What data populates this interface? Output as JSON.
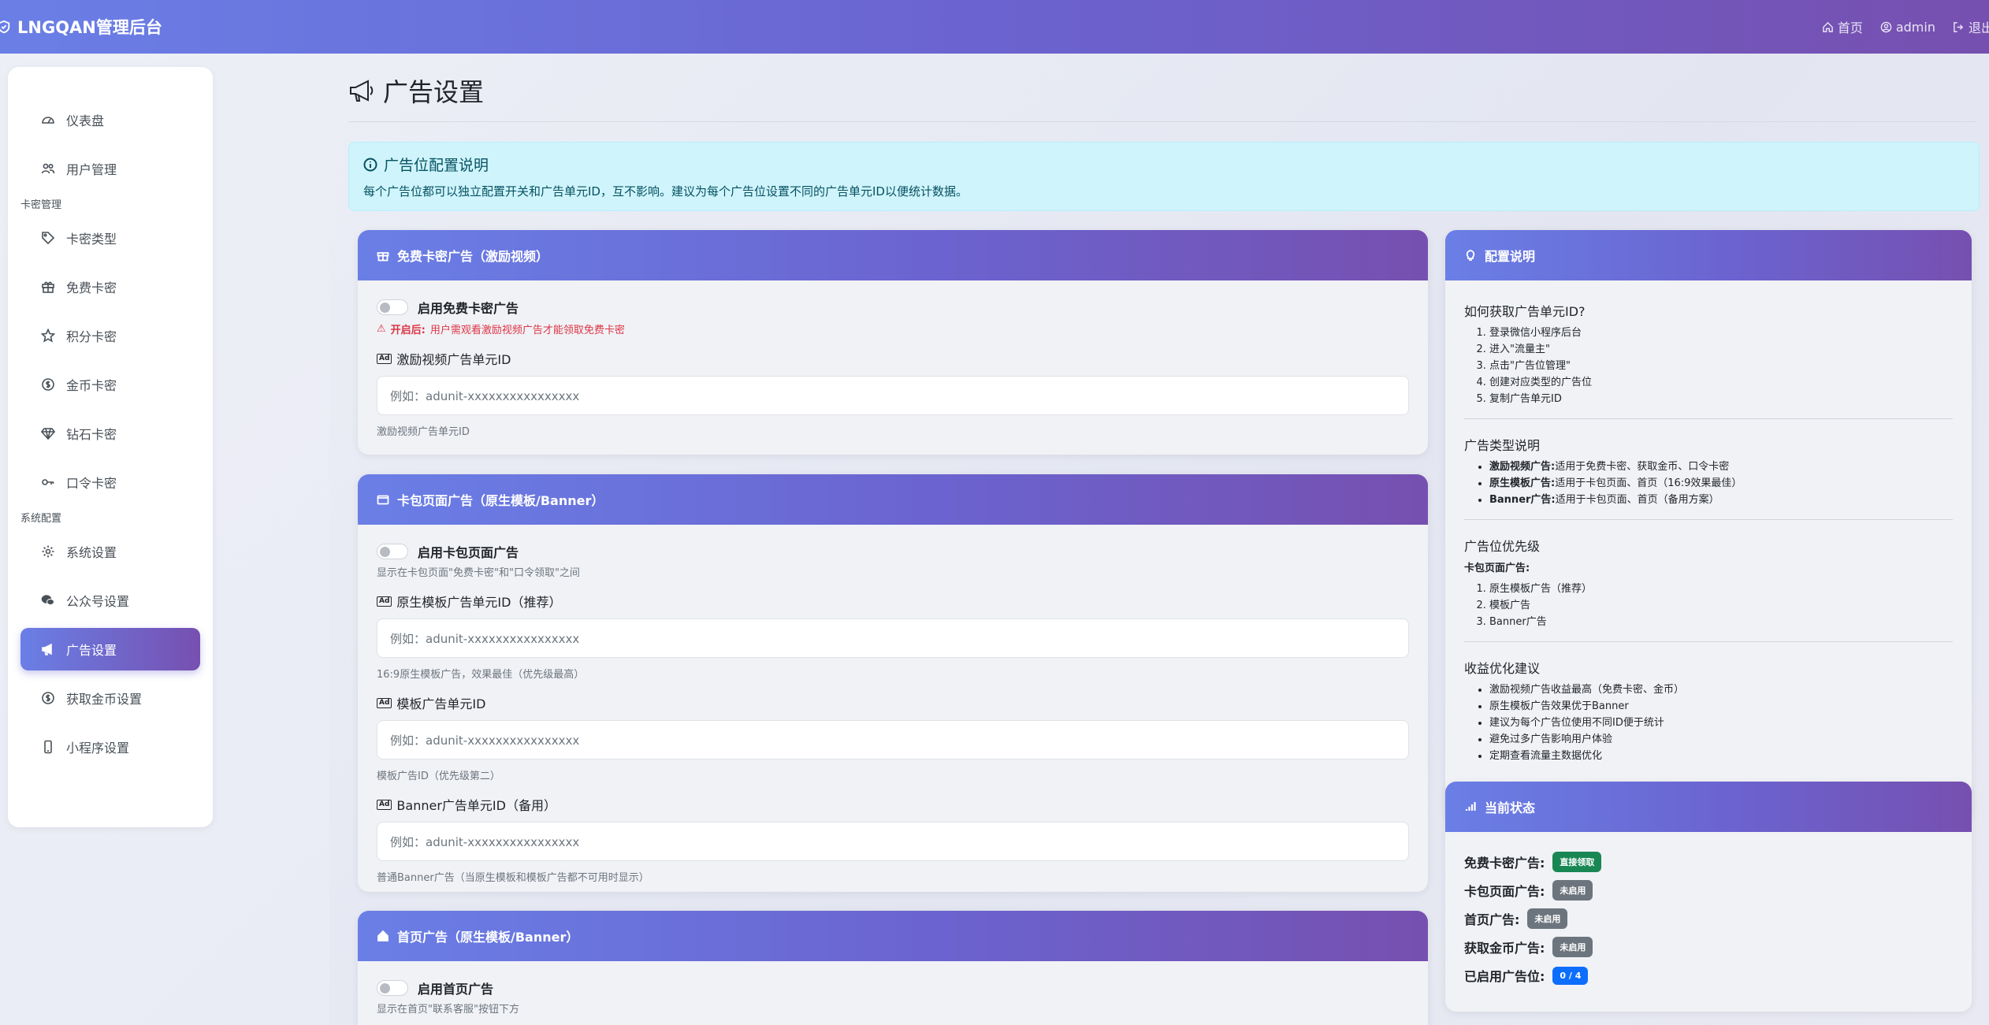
{
  "topbar": {
    "brand": "LNGQAN管理后台",
    "nav": {
      "home": "首页",
      "user": "admin",
      "logout": "退出"
    }
  },
  "sidebar": {
    "items_top": [
      {
        "label": "仪表盘",
        "icon": "dashboard-icon"
      },
      {
        "label": "用户管理",
        "icon": "users-icon"
      }
    ],
    "group_cards": "卡密管理",
    "items_cards": [
      {
        "label": "卡密类型",
        "icon": "tag-icon"
      },
      {
        "label": "免费卡密",
        "icon": "gift-icon"
      },
      {
        "label": "积分卡密",
        "icon": "star-icon"
      },
      {
        "label": "金币卡密",
        "icon": "coin-icon"
      },
      {
        "label": "钻石卡密",
        "icon": "gem-icon"
      },
      {
        "label": "口令卡密",
        "icon": "key-icon"
      }
    ],
    "group_system": "系统配置",
    "items_system": [
      {
        "label": "系统设置",
        "icon": "gear-icon"
      },
      {
        "label": "公众号设置",
        "icon": "wechat-icon"
      },
      {
        "label": "广告设置",
        "icon": "megaphone-icon",
        "active": true
      },
      {
        "label": "获取金币设置",
        "icon": "coin-icon"
      },
      {
        "label": "小程序设置",
        "icon": "phone-icon"
      }
    ]
  },
  "page": {
    "title": "广告设置"
  },
  "alert": {
    "title": "广告位配置说明",
    "body": "每个广告位都可以独立配置开关和广告单元ID，互不影响。建议为每个广告位设置不同的广告单元ID以便统计数据。"
  },
  "free_ad": {
    "header": "免费卡密广告（激励视频）",
    "toggle_label": "启用免费卡密广告",
    "warn_bold": "开启后:",
    "warn_text": "用户需观看激励视频广告才能领取免费卡密",
    "field_label": "激励视频广告单元ID",
    "placeholder": "例如：adunit-xxxxxxxxxxxxxxxx",
    "help": "激励视频广告单元ID"
  },
  "wallet_ad": {
    "header": "卡包页面广告（原生模板/Banner）",
    "toggle_label": "启用卡包页面广告",
    "toggle_help": "显示在卡包页面\"免费卡密\"和\"口令领取\"之间",
    "f1_label": "原生模板广告单元ID（推荐）",
    "f1_placeholder": "例如：adunit-xxxxxxxxxxxxxxxx",
    "f1_help": "16:9原生模板广告，效果最佳（优先级最高）",
    "f2_label": "模板广告单元ID",
    "f2_placeholder": "例如：adunit-xxxxxxxxxxxxxxxx",
    "f2_help": "模板广告ID（优先级第二）",
    "f3_label": "Banner广告单元ID（备用）",
    "f3_placeholder": "例如：adunit-xxxxxxxxxxxxxxxx",
    "f3_help": "普通Banner广告（当原生模板和模板广告都不可用时显示）"
  },
  "home_ad": {
    "header": "首页广告（原生模板/Banner）",
    "toggle_label": "启用首页广告",
    "toggle_help": "显示在首页\"联系客服\"按钮下方"
  },
  "config_help": {
    "header": "配置说明",
    "s1_title": "如何获取广告单元ID?",
    "s1_steps": [
      "登录微信小程序后台",
      "进入\"流量主\"",
      "点击\"广告位管理\"",
      "创建对应类型的广告位",
      "复制广告单元ID"
    ],
    "s2_title": "广告类型说明",
    "s2_items": [
      {
        "bold": "激励视频广告:",
        "text": "适用于免费卡密、获取金币、口令卡密"
      },
      {
        "bold": "原生模板广告:",
        "text": "适用于卡包页面、首页（16:9效果最佳）"
      },
      {
        "bold": "Banner广告:",
        "text": "适用于卡包页面、首页（备用方案）"
      }
    ],
    "s3_title": "广告位优先级",
    "s3_sub": "卡包页面广告:",
    "s3_steps": [
      "原生模板广告（推荐）",
      "模板广告",
      "Banner广告"
    ],
    "s4_title": "收益优化建议",
    "s4_items": [
      "激励视频广告收益最高（免费卡密、金币）",
      "原生模板广告效果优于Banner",
      "建议为每个广告位使用不同ID便于统计",
      "避免过多广告影响用户体验",
      "定期查看流量主数据优化"
    ]
  },
  "status": {
    "header": "当前状态",
    "rows": [
      {
        "label": "免费卡密广告:",
        "badge": "直接领取",
        "color": "#198754"
      },
      {
        "label": "卡包页面广告:",
        "badge": "未启用",
        "color": "#6c757d"
      },
      {
        "label": "首页广告:",
        "badge": "未启用",
        "color": "#6c757d"
      },
      {
        "label": "获取金币广告:",
        "badge": "未启用",
        "color": "#6c757d"
      },
      {
        "label": "已启用广告位:",
        "badge": "0 / 4",
        "color": "#0d6efd"
      }
    ]
  }
}
